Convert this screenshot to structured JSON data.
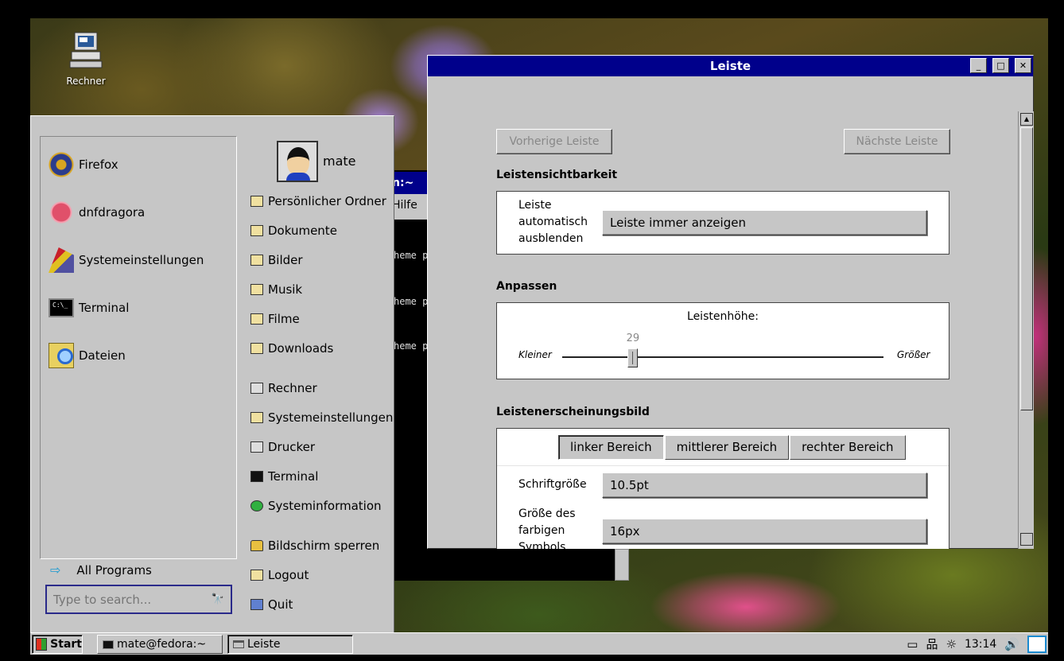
{
  "desktop": {
    "icons": [
      {
        "label": "Rechner",
        "icon": "computer-icon"
      }
    ]
  },
  "terminal": {
    "title_fragment": "n:~",
    "menu_fragment": "Hilfe",
    "lines": [
      "heme p",
      "heme p",
      "heme p"
    ]
  },
  "start_menu": {
    "favorites": [
      {
        "label": "Firefox",
        "icon": "firefox-icon"
      },
      {
        "label": "dnfdragora",
        "icon": "dnfdragora-icon"
      },
      {
        "label": "Systemeinstellungen",
        "icon": "system-settings-icon"
      },
      {
        "label": "Terminal",
        "icon": "terminal-icon"
      },
      {
        "label": "Dateien",
        "icon": "files-icon"
      }
    ],
    "user": "mate",
    "places": [
      {
        "label": "Persönlicher Ordner",
        "icon": "home-folder-icon"
      },
      {
        "label": "Dokumente",
        "icon": "documents-folder-icon"
      },
      {
        "label": "Bilder",
        "icon": "pictures-folder-icon"
      },
      {
        "label": "Musik",
        "icon": "music-folder-icon"
      },
      {
        "label": "Filme",
        "icon": "videos-folder-icon"
      },
      {
        "label": "Downloads",
        "icon": "downloads-folder-icon"
      }
    ],
    "system": [
      {
        "label": "Rechner",
        "icon": "computer-icon"
      },
      {
        "label": "Systemeinstellungen",
        "icon": "system-settings-icon"
      },
      {
        "label": "Drucker",
        "icon": "printer-icon"
      },
      {
        "label": "Terminal",
        "icon": "terminal-icon"
      },
      {
        "label": "Systeminformation",
        "icon": "system-info-icon"
      }
    ],
    "session": [
      {
        "label": "Bildschirm sperren",
        "icon": "lock-icon"
      },
      {
        "label": "Logout",
        "icon": "logout-icon"
      },
      {
        "label": "Quit",
        "icon": "quit-icon"
      }
    ],
    "all_programs": "All Programs",
    "search_placeholder": "Type to search..."
  },
  "panel_window": {
    "title": "Leiste",
    "prev_button": "Vorherige Leiste",
    "next_button": "Nächste Leiste",
    "visibility": {
      "title": "Leistensichtbarkeit",
      "label_lines": [
        "Leiste",
        "automatisch",
        "ausblenden"
      ],
      "value": "Leiste immer anzeigen"
    },
    "customize": {
      "title": "Anpassen",
      "height_label": "Leistenhöhe:",
      "height_value": "29",
      "min_label": "Kleiner",
      "max_label": "Größer",
      "height_fraction": 0.22
    },
    "appearance": {
      "title": "Leistenerscheinungsbild",
      "tabs": [
        "linker Bereich",
        "mittlerer Bereich",
        "rechter Bereich"
      ],
      "font_size_label": "Schriftgröße",
      "font_size_value": "10.5pt",
      "icon_size_label_lines": [
        "Größe des",
        "farbigen",
        "Symbols"
      ],
      "icon_size_value": "16px"
    }
  },
  "taskbar": {
    "start": "Start",
    "tasks": [
      {
        "label": "mate@fedora:~",
        "icon": "terminal-icon"
      },
      {
        "label": "Leiste",
        "icon": "window-icon"
      }
    ],
    "clock": "13:14"
  }
}
